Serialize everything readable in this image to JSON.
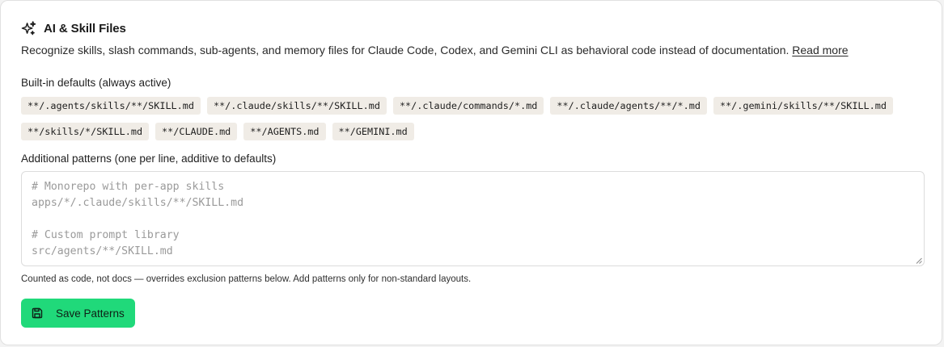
{
  "section": {
    "title": "AI & Skill Files",
    "icon": "sparkles-icon",
    "description": "Recognize skills, slash commands, sub-agents, and memory files for Claude Code, Codex, and Gemini CLI as behavioral code instead of documentation.",
    "read_more": "Read more"
  },
  "builtin": {
    "label": "Built-in defaults (always active)",
    "patterns_row1": [
      "**/.agents/skills/**/SKILL.md",
      "**/.claude/skills/**/SKILL.md",
      "**/.claude/commands/*.md",
      "**/.claude/agents/**/*.md",
      "**/.gemini/skills/**/SKILL.md"
    ],
    "patterns_row2": [
      "**/skills/*/SKILL.md",
      "**/CLAUDE.md",
      "**/AGENTS.md",
      "**/GEMINI.md"
    ]
  },
  "additional": {
    "label": "Additional patterns (one per line, additive to defaults)",
    "value": "",
    "placeholder": "# Monorepo with per-app skills\napps/*/.claude/skills/**/SKILL.md\n\n# Custom prompt library\nsrc/agents/**/SKILL.md",
    "hint": "Counted as code, not docs — overrides exclusion patterns below. Add patterns only for non-standard layouts."
  },
  "save_button": {
    "label": "Save Patterns",
    "icon": "save-icon"
  },
  "colors": {
    "accent": "#20d97a",
    "chip_bg": "#f0ece6"
  }
}
